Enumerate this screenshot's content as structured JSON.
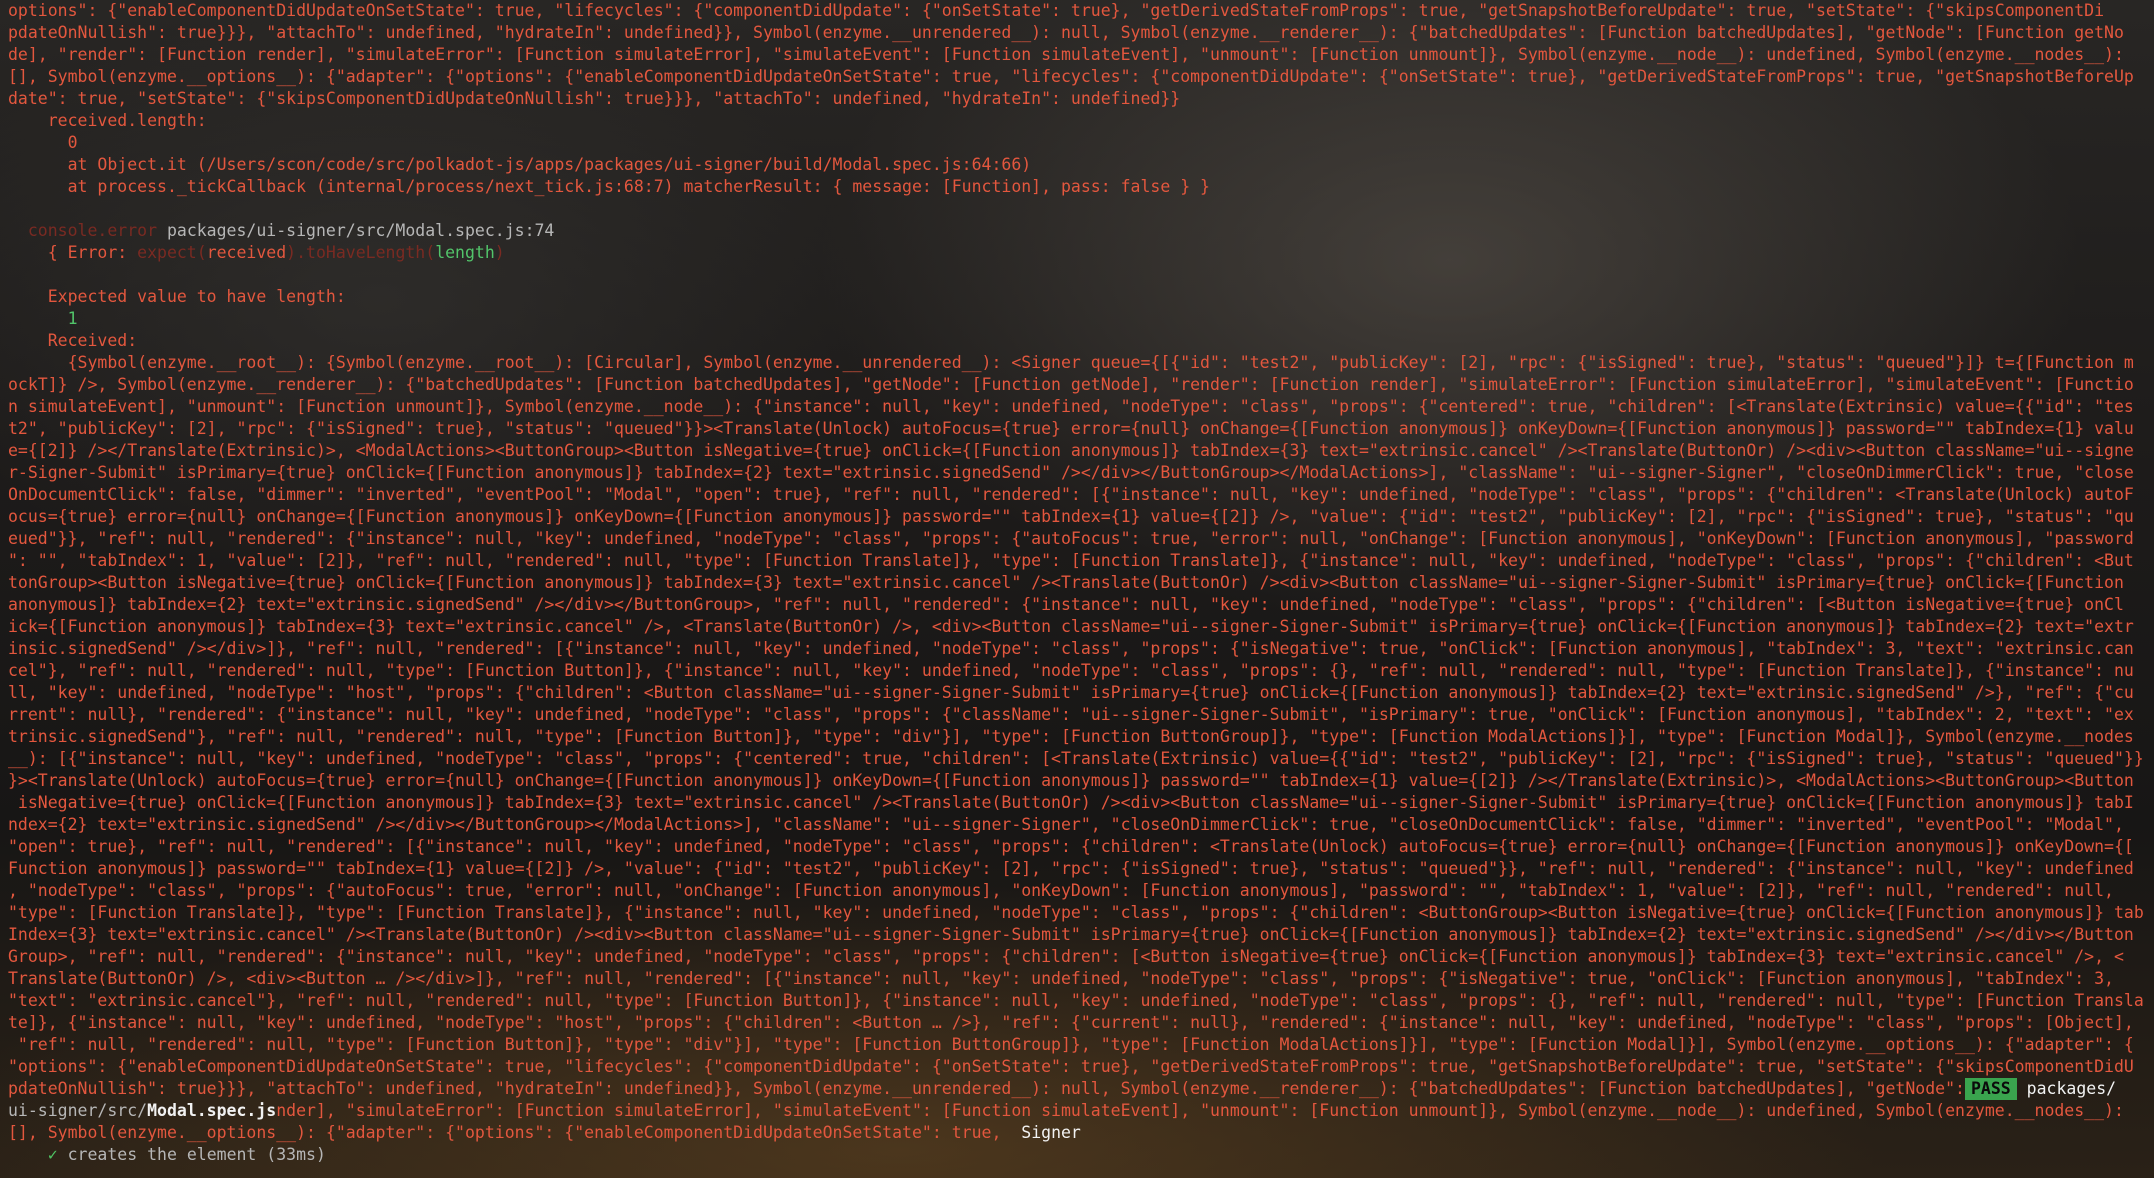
{
  "terminal": {
    "block1": [
      "options\": {\"enableComponentDidUpdateOnSetState\": true, \"lifecycles\": {\"componentDidUpdate\": {\"onSetState\": true}, \"getDerivedStateFromProps\": true, \"getSnapshotBeforeUpdate\": true, \"setState\": {\"skipsComponentDi",
      "pdateOnNullish\": true}}}, \"attachTo\": undefined, \"hydrateIn\": undefined}}, Symbol(enzyme.__unrendered__): null, Symbol(enzyme.__renderer__): {\"batchedUpdates\": [Function batchedUpdates], \"getNode\": [Function getNo",
      "de], \"render\": [Function render], \"simulateError\": [Function simulateError], \"simulateEvent\": [Function simulateEvent], \"unmount\": [Function unmount]}, Symbol(enzyme.__node__): undefined, Symbol(enzyme.__nodes__):",
      "[], Symbol(enzyme.__options__): {\"adapter\": {\"options\": {\"enableComponentDidUpdateOnSetState\": true, \"lifecycles\": {\"componentDidUpdate\": {\"onSetState\": true}, \"getDerivedStateFromProps\": true, \"getSnapshotBeforeUp",
      "date\": true, \"setState\": {\"skipsComponentDidUpdateOnNullish\": true}}}, \"attachTo\": undefined, \"hydrateIn\": undefined}}"
    ],
    "received_length_label": "    received.length:",
    "received_length_value": "      0",
    "stack1": "      at Object.it (/Users/scon/code/src/polkadot-js/apps/packages/ui-signer/build/Modal.spec.js:64:66)",
    "stack2": "      at process._tickCallback (internal/process/next_tick.js:68:7) matcherResult: { message: [Function], pass: false } }",
    "console_error_tag": "  console.error",
    "console_error_path": " packages/ui-signer/src/Modal.spec.js:74",
    "error_prefix": "    { Error: ",
    "error_expect": "expect(",
    "error_received": "received",
    "error_matcher": ").toHaveLength(",
    "error_length": "length",
    "error_close": ")",
    "expected_label": "    Expected value to have length:",
    "expected_value": "      1",
    "received_label": "    Received:",
    "block2": [
      "      {Symbol(enzyme.__root__): {Symbol(enzyme.__root__): [Circular], Symbol(enzyme.__unrendered__): <Signer queue={[{\"id\": \"test2\", \"publicKey\": [2], \"rpc\": {\"isSigned\": true}, \"status\": \"queued\"}]} t={[Function m",
      "ockT]} />, Symbol(enzyme.__renderer__): {\"batchedUpdates\": [Function batchedUpdates], \"getNode\": [Function getNode], \"render\": [Function render], \"simulateError\": [Function simulateError], \"simulateEvent\": [Functio",
      "n simulateEvent], \"unmount\": [Function unmount]}, Symbol(enzyme.__node__): {\"instance\": null, \"key\": undefined, \"nodeType\": \"class\", \"props\": {\"centered\": true, \"children\": [<Translate(Extrinsic) value={{\"id\": \"tes",
      "t2\", \"publicKey\": [2], \"rpc\": {\"isSigned\": true}, \"status\": \"queued\"}}><Translate(Unlock) autoFocus={true} error={null} onChange={[Function anonymous]} onKeyDown={[Function anonymous]} password=\"\" tabIndex={1} valu",
      "e={[2]} /></Translate(Extrinsic)>, <ModalActions><ButtonGroup><Button isNegative={true} onClick={[Function anonymous]} tabIndex={3} text=\"extrinsic.cancel\" /><Translate(ButtonOr) /><div><Button className=\"ui--signe",
      "r-Signer-Submit\" isPrimary={true} onClick={[Function anonymous]} tabIndex={2} text=\"extrinsic.signedSend\" /></div></ButtonGroup></ModalActions>], \"className\": \"ui--signer-Signer\", \"closeOnDimmerClick\": true, \"close",
      "OnDocumentClick\": false, \"dimmer\": \"inverted\", \"eventPool\": \"Modal\", \"open\": true}, \"ref\": null, \"rendered\": [{\"instance\": null, \"key\": undefined, \"nodeType\": \"class\", \"props\": {\"children\": <Translate(Unlock) autoF",
      "ocus={true} error={null} onChange={[Function anonymous]} onKeyDown={[Function anonymous]} password=\"\" tabIndex={1} value={[2]} />, \"value\": {\"id\": \"test2\", \"publicKey\": [2], \"rpc\": {\"isSigned\": true}, \"status\": \"qu",
      "eued\"}}, \"ref\": null, \"rendered\": {\"instance\": null, \"key\": undefined, \"nodeType\": \"class\", \"props\": {\"autoFocus\": true, \"error\": null, \"onChange\": [Function anonymous], \"onKeyDown\": [Function anonymous], \"password",
      "\": \"\", \"tabIndex\": 1, \"value\": [2]}, \"ref\": null, \"rendered\": null, \"type\": [Function Translate]}, \"type\": [Function Translate]}, {\"instance\": null, \"key\": undefined, \"nodeType\": \"class\", \"props\": {\"children\": <But",
      "tonGroup><Button isNegative={true} onClick={[Function anonymous]} tabIndex={3} text=\"extrinsic.cancel\" /><Translate(ButtonOr) /><div><Button className=\"ui--signer-Signer-Submit\" isPrimary={true} onClick={[Function",
      "anonymous]} tabIndex={2} text=\"extrinsic.signedSend\" /></div></ButtonGroup>, \"ref\": null, \"rendered\": {\"instance\": null, \"key\": undefined, \"nodeType\": \"class\", \"props\": {\"children\": [<Button isNegative={true} onCl",
      "ick={[Function anonymous]} tabIndex={3} text=\"extrinsic.cancel\" />, <Translate(ButtonOr) />, <div><Button className=\"ui--signer-Signer-Submit\" isPrimary={true} onClick={[Function anonymous]} tabIndex={2} text=\"extr",
      "insic.signedSend\" /></div>]}, \"ref\": null, \"rendered\": [{\"instance\": null, \"key\": undefined, \"nodeType\": \"class\", \"props\": {\"isNegative\": true, \"onClick\": [Function anonymous], \"tabIndex\": 3, \"text\": \"extrinsic.can",
      "cel\"}, \"ref\": null, \"rendered\": null, \"type\": [Function Button]}, {\"instance\": null, \"key\": undefined, \"nodeType\": \"class\", \"props\": {}, \"ref\": null, \"rendered\": null, \"type\": [Function Translate]}, {\"instance\": nu",
      "ll, \"key\": undefined, \"nodeType\": \"host\", \"props\": {\"children\": <Button className=\"ui--signer-Signer-Submit\" isPrimary={true} onClick={[Function anonymous]} tabIndex={2} text=\"extrinsic.signedSend\" />}, \"ref\": {\"cu",
      "rrent\": null}, \"rendered\": {\"instance\": null, \"key\": undefined, \"nodeType\": \"class\", \"props\": {\"className\": \"ui--signer-Signer-Submit\", \"isPrimary\": true, \"onClick\": [Function anonymous], \"tabIndex\": 2, \"text\": \"ex",
      "trinsic.signedSend\"}, \"ref\": null, \"rendered\": null, \"type\": [Function Button]}, \"type\": \"div\"}], \"type\": [Function ButtonGroup]}, \"type\": [Function ModalActions]}], \"type\": [Function Modal]}, Symbol(enzyme.__nodes",
      "__): [{\"instance\": null, \"key\": undefined, \"nodeType\": \"class\", \"props\": {\"centered\": true, \"children\": [<Translate(Extrinsic) value={{\"id\": \"test2\", \"publicKey\": [2], \"rpc\": {\"isSigned\": true}, \"status\": \"queued\"}}",
      "}><Translate(Unlock) autoFocus={true} error={null} onChange={[Function anonymous]} onKeyDown={[Function anonymous]} password=\"\" tabIndex={1} value={[2]} /></Translate(Extrinsic)>, <ModalActions><ButtonGroup><Button",
      " isNegative={true} onClick={[Function anonymous]} tabIndex={3} text=\"extrinsic.cancel\" /><Translate(ButtonOr) /><div><Button className=\"ui--signer-Signer-Submit\" isPrimary={true} onClick={[Function anonymous]} tabI",
      "ndex={2} text=\"extrinsic.signedSend\" /></div></ButtonGroup></ModalActions>], \"className\": \"ui--signer-Signer\", \"closeOnDimmerClick\": true, \"closeOnDocumentClick\": false, \"dimmer\": \"inverted\", \"eventPool\": \"Modal\",",
      "\"open\": true}, \"ref\": null, \"rendered\": [{\"instance\": null, \"key\": undefined, \"nodeType\": \"class\", \"props\": {\"children\": <Translate(Unlock) autoFocus={true} error={null} onChange={[Function anonymous]} onKeyDown={[",
      "Function anonymous]} password=\"\" tabIndex={1} value={[2]} />, \"value\": {\"id\": \"test2\", \"publicKey\": [2], \"rpc\": {\"isSigned\": true}, \"status\": \"queued\"}}, \"ref\": null, \"rendered\": {\"instance\": null, \"key\": undefined",
      ", \"nodeType\": \"class\", \"props\": {\"autoFocus\": true, \"error\": null, \"onChange\": [Function anonymous], \"onKeyDown\": [Function anonymous], \"password\": \"\", \"tabIndex\": 1, \"value\": [2]}, \"ref\": null, \"rendered\": null,",
      "\"type\": [Function Translate]}, \"type\": [Function Translate]}, {\"instance\": null, \"key\": undefined, \"nodeType\": \"class\", \"props\": {\"children\": <ButtonGroup><Button isNegative={true} onClick={[Function anonymous]} tab",
      "Index={3} text=\"extrinsic.cancel\" /><Translate(ButtonOr) /><div><Button className=\"ui--signer-Signer-Submit\" isPrimary={true} onClick={[Function anonymous]} tabIndex={2} text=\"extrinsic.signedSend\" /></div></Button",
      "Group>, \"ref\": null, \"rendered\": {\"instance\": null, \"key\": undefined, \"nodeType\": \"class\", \"props\": {\"children\": [<Button isNegative={true} onClick={[Function anonymous]} tabIndex={3} text=\"extrinsic.cancel\" />, <",
      "Translate(ButtonOr) />, <div><Button … /></div>]}, \"ref\": null, \"rendered\": [{\"instance\": null, \"key\": undefined, \"nodeType\": \"class\", \"props\": {\"isNegative\": true, \"onClick\": [Function anonymous], \"tabIndex\": 3,",
      "\"text\": \"extrinsic.cancel\"}, \"ref\": null, \"rendered\": null, \"type\": [Function Button]}, {\"instance\": null, \"key\": undefined, \"nodeType\": \"class\", \"props\": {}, \"ref\": null, \"rendered\": null, \"type\": [Function Transla",
      "te]}, {\"instance\": null, \"key\": undefined, \"nodeType\": \"host\", \"props\": {\"children\": <Button … />}, \"ref\": {\"current\": null}, \"rendered\": {\"instance\": null, \"key\": undefined, \"nodeType\": \"class\", \"props\": [Object],",
      " \"ref\": null, \"rendered\": null, \"type\": [Function Button]}, \"type\": \"div\"}], \"type\": [Function ButtonGroup]}, \"type\": [Function ModalActions]}], \"type\": [Function Modal]}], Symbol(enzyme.__options__): {\"adapter\": {",
      "\"options\": {\"enableComponentDidUpdateOnSetState\": true, \"lifecycles\": {\"componentDidUpdate\": {\"onSetState\": true}, \"getDerivedStateFromProps\": true, \"getSnapshotBeforeUpdate\": true, \"setState\": {\"skipsComponentDidU"
    ],
    "pass_line_text": "pdateOnNullish\": true}}}, \"attachTo\": undefined, \"hydrateIn\": undefined}}, Symbol(enzyme.__unrendered__): null, Symbol(enzyme.__renderer__): {\"batchedUpdates\": [Function batchedUpdates], \"getNode\":",
    "pass_badge": "PASS",
    "pass_path": " packages/",
    "file_dir": "ui-signer/src/",
    "file_name": "Modal.spec.js",
    "file_line_rest": "nder], \"simulateError\": [Function simulateError], \"simulateEvent\": [Function simulateEvent], \"unmount\": [Function unmount]}, Symbol(enzyme.__node__): undefined, Symbol(enzyme.__nodes__):",
    "options_line": "[], Symbol(enzyme.__options__): {\"adapter\": {\"options\": {\"enableComponentDidUpdateOnSetState\": true,  ",
    "suite_name": "Signer",
    "check_mark": "✓",
    "test_name": " creates the element (33ms)"
  }
}
